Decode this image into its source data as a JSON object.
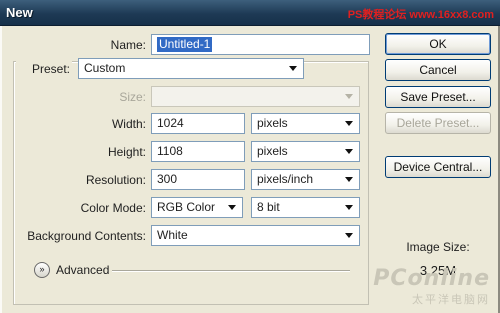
{
  "window": {
    "title": "New"
  },
  "watermark": {
    "top": "PS教程论坛 www.16xx8.com",
    "brand": "PConline",
    "sub": "太平洋电脑网"
  },
  "form": {
    "name_label": "Name:",
    "name_value": "Untitled-1",
    "preset_label": "Preset:",
    "preset_value": "Custom",
    "size_label": "Size:",
    "size_value": "",
    "width_label": "Width:",
    "width_value": "1024",
    "width_unit": "pixels",
    "height_label": "Height:",
    "height_value": "1108",
    "height_unit": "pixels",
    "resolution_label": "Resolution:",
    "resolution_value": "300",
    "resolution_unit": "pixels/inch",
    "color_mode_label": "Color Mode:",
    "color_mode_value": "RGB Color",
    "bit_depth_value": "8 bit",
    "background_label": "Background Contents:",
    "background_value": "White",
    "advanced_label": "Advanced"
  },
  "buttons": {
    "ok": "OK",
    "cancel": "Cancel",
    "save_preset": "Save Preset...",
    "delete_preset": "Delete Preset...",
    "device_central": "Device Central..."
  },
  "image_size": {
    "label": "Image Size:",
    "value": "3.25M"
  },
  "colors": {
    "selection": "#316ac5",
    "dialog_bg": "#ece9d8"
  }
}
